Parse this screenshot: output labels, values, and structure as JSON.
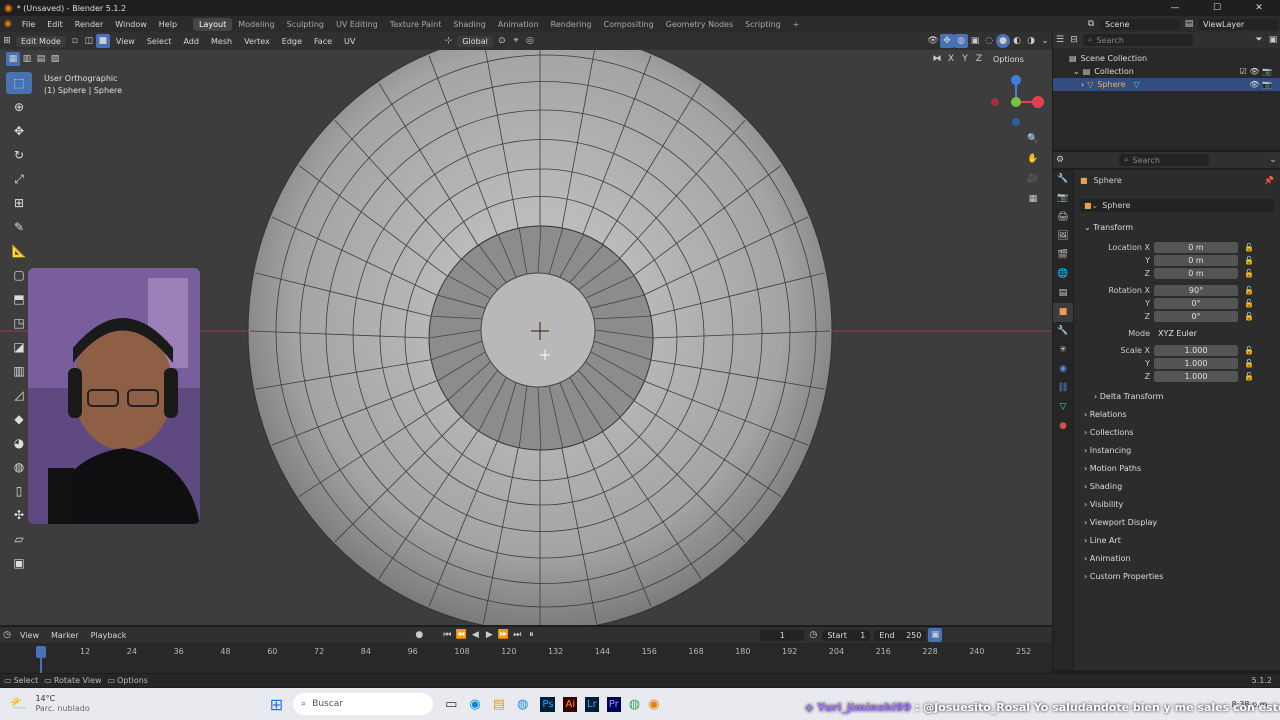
{
  "window": {
    "title": "* (Unsaved) - Blender 5.1.2",
    "controls": [
      "—",
      "☐",
      "✕"
    ]
  },
  "menu": [
    "File",
    "Edit",
    "Render",
    "Window",
    "Help"
  ],
  "workspaces": [
    {
      "label": "Layout",
      "active": true
    },
    {
      "label": "Modeling"
    },
    {
      "label": "Sculpting"
    },
    {
      "label": "UV Editing"
    },
    {
      "label": "Texture Paint"
    },
    {
      "label": "Shading"
    },
    {
      "label": "Animation"
    },
    {
      "label": "Rendering"
    },
    {
      "label": "Compositing"
    },
    {
      "label": "Geometry Nodes"
    },
    {
      "label": "Scripting"
    }
  ],
  "add_workspace": "+",
  "scene": {
    "label": "Scene",
    "view_layer": "ViewLayer"
  },
  "viewport_header": {
    "mode": "Edit Mode",
    "menus": [
      "View",
      "Select",
      "Add",
      "Mesh",
      "Vertex",
      "Edge",
      "Face",
      "UV"
    ],
    "orientation": "Global",
    "options": "Options",
    "axes": [
      "X",
      "Y",
      "Z"
    ]
  },
  "viewport": {
    "view_name": "User Orthographic",
    "object_info": "(1) Sphere | Sphere"
  },
  "outliner": {
    "search_placeholder": "Search",
    "items": [
      {
        "label": "Scene Collection"
      },
      {
        "label": "Collection"
      },
      {
        "label": "Sphere"
      }
    ]
  },
  "properties": {
    "search_placeholder": "Search",
    "object_name": "Sphere",
    "datablock": "Sphere",
    "transform": {
      "title": "Transform",
      "location": {
        "label": "Location X",
        "x": "0 m",
        "y": "0 m",
        "z": "0 m"
      },
      "rotation": {
        "label": "Rotation X",
        "x": "90°",
        "y": "0°",
        "z": "0°"
      },
      "mode_label": "Mode",
      "mode": "XYZ Euler",
      "scale": {
        "label": "Scale X",
        "x": "1.000",
        "y": "1.000",
        "z": "1.000"
      },
      "y_label": "Y",
      "z_label": "Z",
      "delta": "Delta Transform"
    },
    "sections": [
      "Relations",
      "Collections",
      "Instancing",
      "Motion Paths",
      "Shading",
      "Visibility",
      "Viewport Display",
      "Line Art",
      "Animation",
      "Custom Properties"
    ]
  },
  "timeline": {
    "menus": [
      "View",
      "Marker",
      "Playback"
    ],
    "current_frame": "1",
    "start_label": "Start",
    "start": "1",
    "end_label": "End",
    "end": "250",
    "ticks": [
      "1",
      "12",
      "24",
      "36",
      "48",
      "60",
      "72",
      "84",
      "96",
      "108",
      "120",
      "132",
      "144",
      "156",
      "168",
      "180",
      "192",
      "204",
      "216",
      "228",
      "240",
      "252"
    ]
  },
  "statusbar": {
    "items": [
      "Select",
      "Rotate View",
      "Options"
    ],
    "version": "5.1.2"
  },
  "taskbar": {
    "weather_temp": "14°C",
    "weather_desc": "Parc. nublado",
    "search": "Buscar",
    "time": "8:38 p.m."
  },
  "chat": {
    "user": "Yuri_jiminshi99",
    "message": ": @Josuesito_Rosal Yo saludándote bien y me sales con esto"
  },
  "colors": {
    "accent": "#4772b3",
    "x_axis": "#e04050",
    "y_axis": "#7ec13d",
    "z_axis": "#3d7fe0"
  }
}
